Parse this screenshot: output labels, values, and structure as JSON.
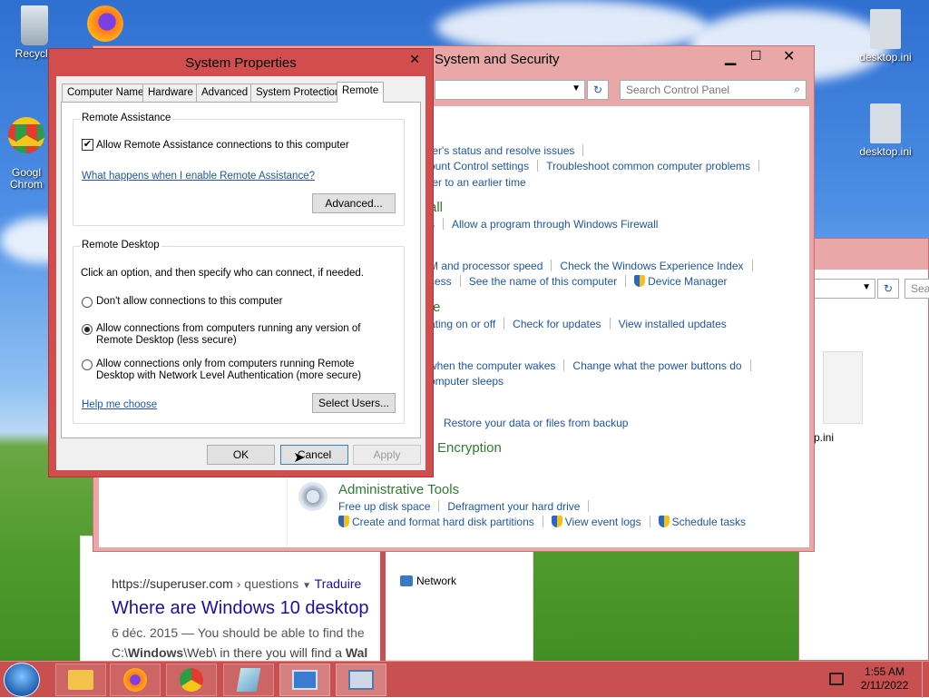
{
  "desktop": {
    "icons": [
      {
        "label": "Recycle"
      },
      {
        "label": "Googl\nChrom"
      },
      {
        "label": "desktop.ini"
      },
      {
        "label": "desktop.ini"
      }
    ]
  },
  "control_panel": {
    "title": "System and Security",
    "search_placeholder": "Search Control Panel",
    "links": {
      "status": "ter's status and resolve issues",
      "uac": "ount Control settings",
      "troubleshoot": "Troubleshoot common computer problems",
      "restore": "ter to an earlier time",
      "firewall_heading": "all",
      "firewall_prefix": "s",
      "allow_program": "Allow a program through Windows Firewall",
      "ram": "M and processor speed",
      "experience": "Check the Windows Experience Index",
      "access": "cess",
      "computer_name": "See the name of this computer",
      "device_manager": "Device Manager",
      "update_heading": "te",
      "auto_update": "ating on or off",
      "check_updates": "Check for updates",
      "installed_updates": "View installed updates",
      "wakes": "when the computer wakes",
      "power_buttons": "Change what the power buttons do",
      "sleeps": "omputer sleeps",
      "backup": "Restore your data or files from backup",
      "encryption_heading": "Encryption",
      "admin_heading": "Administrative Tools",
      "free_disk": "Free up disk space",
      "defrag": "Defragment your hard drive",
      "partitions": "Create and format hard disk partitions",
      "event_logs": "View event logs",
      "schedule": "Schedule tasks"
    }
  },
  "explorer_back": {
    "search_partial": "Sea",
    "file_partial": "p.ini"
  },
  "browser_back": {
    "url": "https://superuser.com",
    "crumb": "› questions",
    "translate": "Traduire",
    "result_title": "Where are Windows 10 desktop",
    "snippet_1": "6 déc. 2015 — You should be able to find the",
    "snippet_2_pre": "C:\\",
    "snippet_2_bold1": "Windows",
    "snippet_2_mid": "\\Web\\ in there you will find a ",
    "snippet_2_bold2": "Wal",
    "network": "Network"
  },
  "dialog": {
    "title": "System Properties",
    "tabs": [
      "Computer Name",
      "Hardware",
      "Advanced",
      "System Protection",
      "Remote"
    ],
    "active_tab": "Remote",
    "remote_assistance": {
      "legend": "Remote Assistance",
      "checkbox_label": "Allow Remote Assistance connections to this computer",
      "checked": true,
      "help_link": "What happens when I enable Remote Assistance?",
      "advanced_button": "Advanced..."
    },
    "remote_desktop": {
      "legend": "Remote Desktop",
      "instruction": "Click an option, and then specify who can connect, if needed.",
      "options": [
        {
          "label": "Don't allow connections to this computer",
          "selected": false
        },
        {
          "label": "Allow connections from computers running any version of\nRemote Desktop (less secure)",
          "selected": true
        },
        {
          "label": "Allow connections only from computers running Remote\nDesktop with Network Level Authentication (more secure)",
          "selected": false
        }
      ],
      "help_link": "Help me choose",
      "select_users_button": "Select Users..."
    },
    "ok": "OK",
    "cancel": "Cancel",
    "apply": "Apply"
  },
  "taskbar": {
    "time": "1:55 AM",
    "date": "2/11/2022"
  },
  "colors": {
    "accent": "#c85050",
    "titlebar": "#e9a7a7",
    "link": "#1e56a8",
    "heading": "#2e7d32"
  }
}
